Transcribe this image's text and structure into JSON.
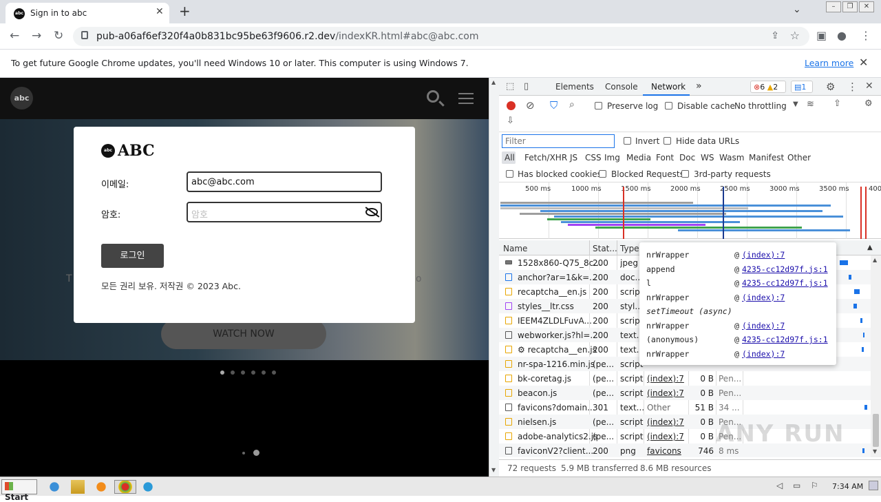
{
  "browser": {
    "tab_title": "Sign in to abc",
    "url_host": "pub-a06af6ef320f4a0b831bc95be63f9606.r2.dev",
    "url_path": "/indexKR.html#abc@abc.com"
  },
  "infobar": {
    "message": "To get future Google Chrome updates, you'll need Windows 10 or later. This computer is using Windows 7.",
    "link": "Learn more"
  },
  "page": {
    "watch_now": "WATCH NOW",
    "side_left": "T",
    "side_right": "o",
    "modal": {
      "logo_text": "ABC",
      "logo_badge": "abc",
      "email_label": "이메일:",
      "email_value": "abc@abc.com",
      "password_label": "암호:",
      "password_placeholder": "암호",
      "login_button": "로그인",
      "copyright": "모든 권리 보유. 저작권 © 2023 Abc."
    }
  },
  "devtools": {
    "tabs": [
      "Elements",
      "Console",
      "Network"
    ],
    "active_tab": "Network",
    "more_tabs": "»",
    "errors": "6",
    "warnings": "2",
    "messages": "1",
    "preserve_log": "Preserve log",
    "disable_cache": "Disable cache",
    "throttling": "No throttling",
    "filter_placeholder": "Filter",
    "invert": "Invert",
    "hide_data_urls": "Hide data URLs",
    "types": [
      "All",
      "Fetch/XHR",
      "JS",
      "CSS",
      "Img",
      "Media",
      "Font",
      "Doc",
      "WS",
      "Wasm",
      "Manifest",
      "Other"
    ],
    "has_blocked_cookies": "Has blocked cookies",
    "blocked_requests": "Blocked Requests",
    "third_party": "3rd-party requests",
    "timeline_ticks": [
      "500 ms",
      "1000 ms",
      "1500 ms",
      "2000 ms",
      "2500 ms",
      "3000 ms",
      "3500 ms",
      "400"
    ],
    "columns": {
      "name": "Name",
      "status": "Stat...",
      "type": "Type"
    },
    "rows": [
      {
        "name": "1528x860-Q75_8c...",
        "status": "200",
        "type": "jpeg",
        "initiator": "",
        "size": "",
        "time": ""
      },
      {
        "name": "anchor?ar=1&k=...",
        "status": "200",
        "type": "doc...",
        "initiator": "",
        "size": "",
        "time": ""
      },
      {
        "name": "recaptcha__en.js",
        "status": "200",
        "type": "script",
        "initiator": "",
        "size": "",
        "time": ""
      },
      {
        "name": "styles__ltr.css",
        "status": "200",
        "type": "styl...",
        "initiator": "",
        "size": "",
        "time": ""
      },
      {
        "name": "IEEM4ZLDLFuvA...",
        "status": "200",
        "type": "script",
        "initiator": "",
        "size": "",
        "time": ""
      },
      {
        "name": "webworker.js?hl=...",
        "status": "200",
        "type": "text...",
        "initiator": "",
        "size": "",
        "time": ""
      },
      {
        "name": "⚙ recaptcha__en.js",
        "status": "200",
        "type": "text...",
        "initiator": "",
        "size": "",
        "time": ""
      },
      {
        "name": "nr-spa-1216.min.js",
        "status": "(pe...",
        "type": "script",
        "initiator": "",
        "size": "",
        "time": ""
      },
      {
        "name": "bk-coretag.js",
        "status": "(pe...",
        "type": "script",
        "initiator": "(index):7",
        "size": "0 B",
        "time": "Pen..."
      },
      {
        "name": "beacon.js",
        "status": "(pe...",
        "type": "script",
        "initiator": "(index):7",
        "size": "0 B",
        "time": "Pen..."
      },
      {
        "name": "favicons?domain...",
        "status": "301",
        "type": "text...",
        "initiator": "Other",
        "size": "51 B",
        "time": "34 ..."
      },
      {
        "name": "nielsen.js",
        "status": "(pe...",
        "type": "script",
        "initiator": "(index):7",
        "size": "0 B",
        "time": "Pen..."
      },
      {
        "name": "adobe-analytics2.js",
        "status": "(pe...",
        "type": "script",
        "initiator": "(index):7",
        "size": "0 B",
        "time": "Pen..."
      },
      {
        "name": "faviconV2?client...",
        "status": "200",
        "type": "png",
        "initiator": "favicons",
        "size": "746 B",
        "time": "8 ms"
      }
    ],
    "status": {
      "requests": "72 requests",
      "transferred": "5.9 MB transferred",
      "resources": "8.6 MB resources"
    },
    "callstack": [
      {
        "fn": "nrWrapper",
        "at": "@",
        "link": "(index):7"
      },
      {
        "fn": "append",
        "at": "@",
        "link": "4235-cc12d97f.js:1"
      },
      {
        "fn": "l",
        "at": "@",
        "link": "4235-cc12d97f.js:1"
      },
      {
        "fn": "nrWrapper",
        "at": "@",
        "link": "(index):7"
      },
      {
        "fn": "setTimeout (async)",
        "at": "",
        "link": ""
      },
      {
        "fn": "nrWrapper",
        "at": "@",
        "link": "(index):7"
      },
      {
        "fn": "(anonymous)",
        "at": "@",
        "link": "4235-cc12d97f.js:1"
      },
      {
        "fn": "nrWrapper",
        "at": "@",
        "link": "(index):7"
      }
    ]
  },
  "watermark": "ANY RUN",
  "taskbar": {
    "start": "Start",
    "clock": "7:34 AM"
  },
  "colors": {
    "accent": "#1a73e8",
    "error": "#d93025",
    "warning": "#e8a600"
  }
}
